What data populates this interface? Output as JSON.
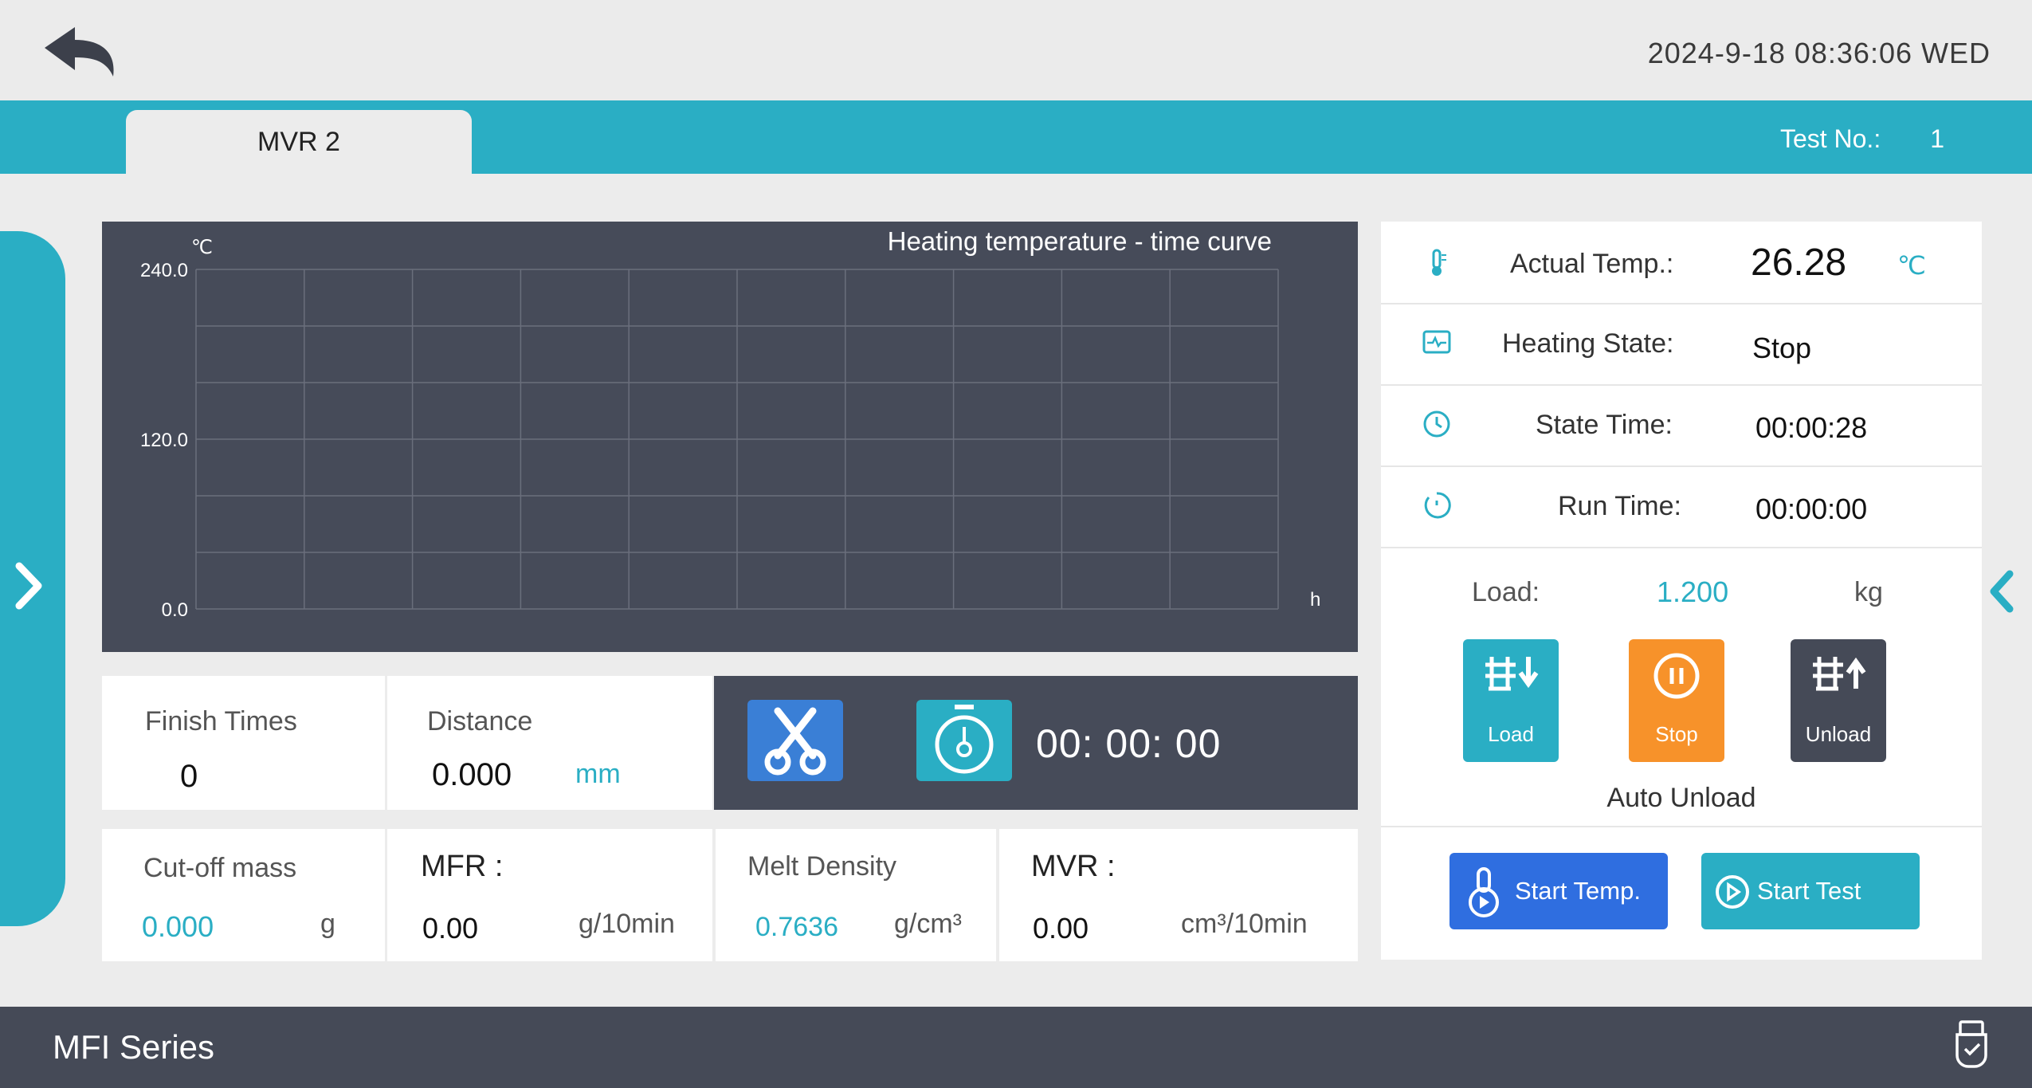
{
  "header": {
    "datetime": "2024-9-18  08:36:06 WED",
    "active_tab": "MVR 2",
    "test_no_label": "Test No.:",
    "test_no_value": "1"
  },
  "chart_data": {
    "type": "line",
    "title": "Heating temperature - time curve",
    "y_unit": "℃",
    "x_unit": "h",
    "y_ticks": [
      "240.0",
      "120.0",
      "0.0"
    ],
    "ylim": [
      0,
      240
    ],
    "grid": true,
    "series": []
  },
  "stats": {
    "finish_times_label": "Finish Times",
    "finish_times_value": "0",
    "distance_label": "Distance",
    "distance_value": "0.000",
    "distance_unit": "mm",
    "timer_value": "00: 00: 00",
    "cutoff_mass_label": "Cut-off mass",
    "cutoff_mass_value": "0.000",
    "cutoff_mass_unit": "g",
    "mfr_label": "MFR :",
    "mfr_value": "0.00",
    "mfr_unit": "g/10min",
    "melt_density_label": "Melt Density",
    "melt_density_value": "0.7636",
    "melt_density_unit": "g/cm³",
    "mvr_label": "MVR :",
    "mvr_value": "0.00",
    "mvr_unit": "cm³/10min"
  },
  "status": {
    "actual_temp_label": "Actual Temp.:",
    "actual_temp_value": "26.28",
    "actual_temp_unit": "℃",
    "heating_state_label": "Heating State:",
    "heating_state_value": "Stop",
    "state_time_label": "State Time:",
    "state_time_value": "00:00:28",
    "run_time_label": "Run Time:",
    "run_time_value": "00:00:00",
    "load_label": "Load:",
    "load_value": "1.200",
    "load_unit": "kg"
  },
  "actions": {
    "load_label": "Load",
    "stop_label": "Stop",
    "unload_label": "Unload",
    "auto_unload_label": "Auto Unload",
    "start_temp_label": "Start Temp.",
    "start_test_label": "Start Test"
  },
  "footer": {
    "title": "MFI Series"
  },
  "colors": {
    "accent": "#2aaec4",
    "dark_panel": "#464b59",
    "stop_orange": "#f7922a",
    "start_temp_blue": "#2f6ee0",
    "unload_dark": "#454a57"
  },
  "icons": [
    "back-arrow-icon",
    "chevron-right-icon",
    "chevron-left-icon",
    "thermometer-icon",
    "heating-state-icon",
    "clock-icon",
    "timer-icon",
    "scissors-icon",
    "stopwatch-icon",
    "load-icon",
    "stop-icon",
    "unload-icon",
    "start-temp-icon",
    "start-test-icon",
    "usb-icon"
  ]
}
